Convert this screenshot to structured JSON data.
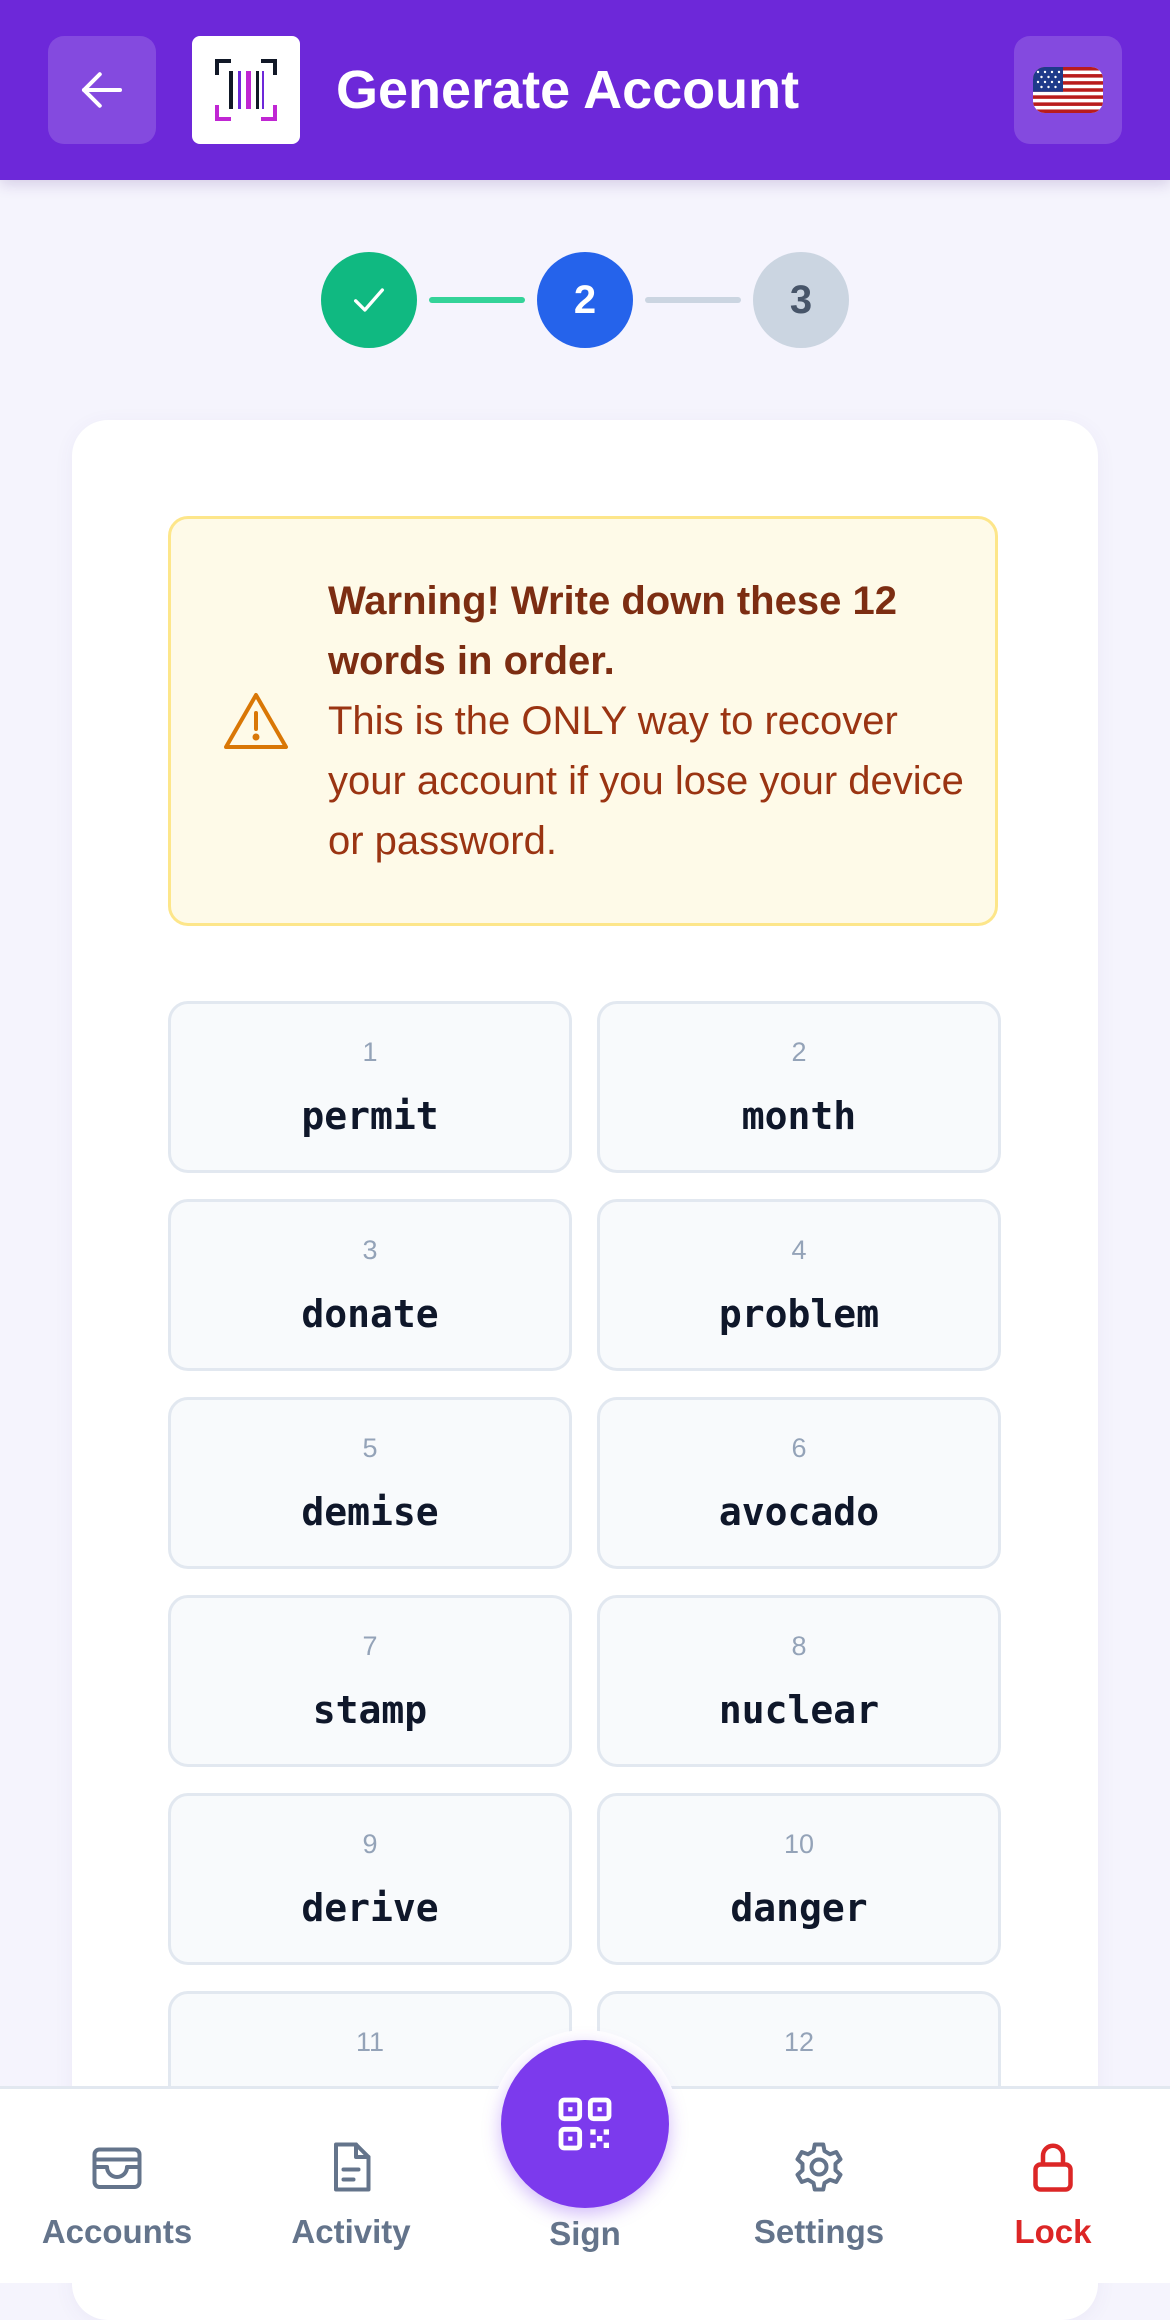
{
  "header": {
    "title": "Generate Account",
    "back_icon": "arrow-left-icon",
    "logo_icon": "barcode-logo-icon",
    "language_icon": "us-flag-icon"
  },
  "stepper": {
    "steps": [
      {
        "label": "",
        "state": "complete",
        "icon": "check-icon"
      },
      {
        "label": "2",
        "state": "current"
      },
      {
        "label": "3",
        "state": "upcoming"
      }
    ],
    "colors": {
      "complete": "#10b981",
      "current": "#2563eb",
      "upcoming": "#cbd5e1"
    }
  },
  "warning": {
    "icon": "warning-triangle-icon",
    "title": "Warning! Write down these 12 words in order.",
    "body": "This is the ONLY way to recover your account if you lose your device or password."
  },
  "mnemonic": {
    "words": [
      {
        "num": "1",
        "word": "permit"
      },
      {
        "num": "2",
        "word": "month"
      },
      {
        "num": "3",
        "word": "donate"
      },
      {
        "num": "4",
        "word": "problem"
      },
      {
        "num": "5",
        "word": "demise"
      },
      {
        "num": "6",
        "word": "avocado"
      },
      {
        "num": "7",
        "word": "stamp"
      },
      {
        "num": "8",
        "word": "nuclear"
      },
      {
        "num": "9",
        "word": "derive"
      },
      {
        "num": "10",
        "word": "danger"
      },
      {
        "num": "11",
        "word": ""
      },
      {
        "num": "12",
        "word": ""
      }
    ]
  },
  "nav": {
    "items": [
      {
        "label": "Accounts",
        "icon": "wallet-icon"
      },
      {
        "label": "Activity",
        "icon": "document-icon"
      },
      {
        "label": "Sign",
        "icon": "qr-code-icon"
      },
      {
        "label": "Settings",
        "icon": "gear-icon"
      },
      {
        "label": "Lock",
        "icon": "lock-icon"
      }
    ],
    "accent": "#7c3aed",
    "danger": "#dc2626"
  }
}
